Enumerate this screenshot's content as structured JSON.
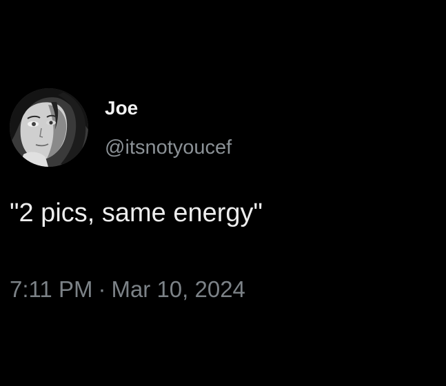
{
  "author": {
    "display_name": "Joe",
    "handle": "@itsnotyoucef",
    "avatar_icon": "anime-character-avatar"
  },
  "tweet": {
    "text": "\"2 pics, same energy\"",
    "time": "7:11 PM",
    "separator": "·",
    "date": "Mar 10, 2024"
  },
  "colors": {
    "background": "#000000",
    "name": "#f2f2f2",
    "handle": "#8b9196",
    "body": "#ededed",
    "meta": "#7c8287"
  }
}
